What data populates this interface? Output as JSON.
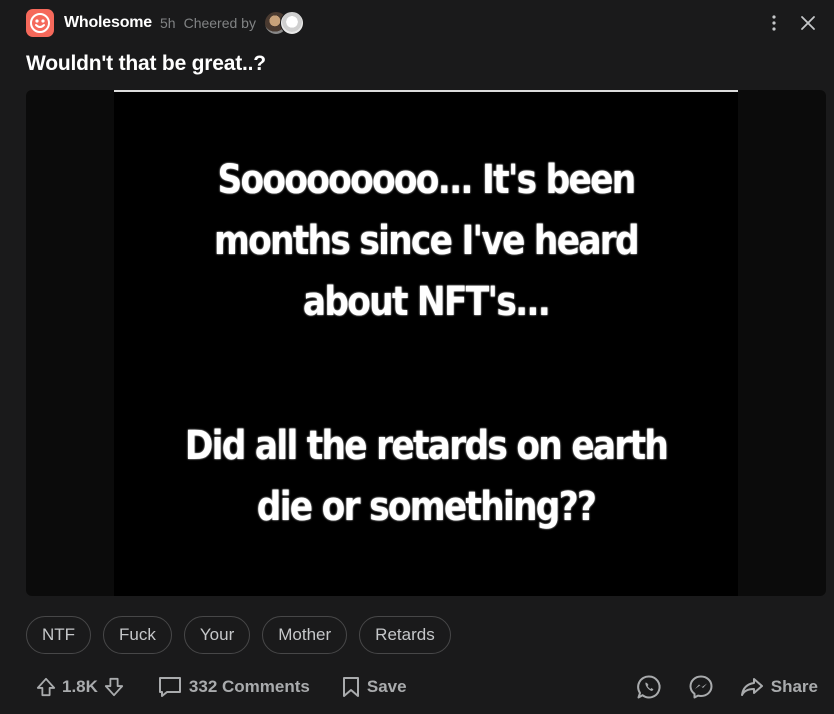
{
  "header": {
    "community_name": "Wholesome",
    "time_ago": "5h",
    "cheered_by_label": "Cheered by",
    "icons": [
      "wholesome-face-icon",
      "more-vertical-icon",
      "close-icon"
    ]
  },
  "post": {
    "title": "Wouldn't that be great..?"
  },
  "media": {
    "line1": "Sooooooooo... It's been",
    "line2": "months since I've heard",
    "line3": "about NFT's...",
    "line4": "Did all the retards on earth",
    "line5": "die or something??"
  },
  "tags": [
    "NTF",
    "Fuck",
    "Your",
    "Mother",
    "Retards"
  ],
  "actions": {
    "vote_count": "1.8K",
    "comments_label": "332 Comments",
    "save_label": "Save",
    "share_label": "Share",
    "icons": [
      "upvote-icon",
      "downvote-icon",
      "comment-icon",
      "bookmark-icon",
      "whatsapp-icon",
      "messenger-icon",
      "share-icon"
    ]
  },
  "colors": {
    "background": "#1a1a1b",
    "accent": "#f5695b",
    "text": "#d7dadc",
    "muted": "#818384"
  }
}
